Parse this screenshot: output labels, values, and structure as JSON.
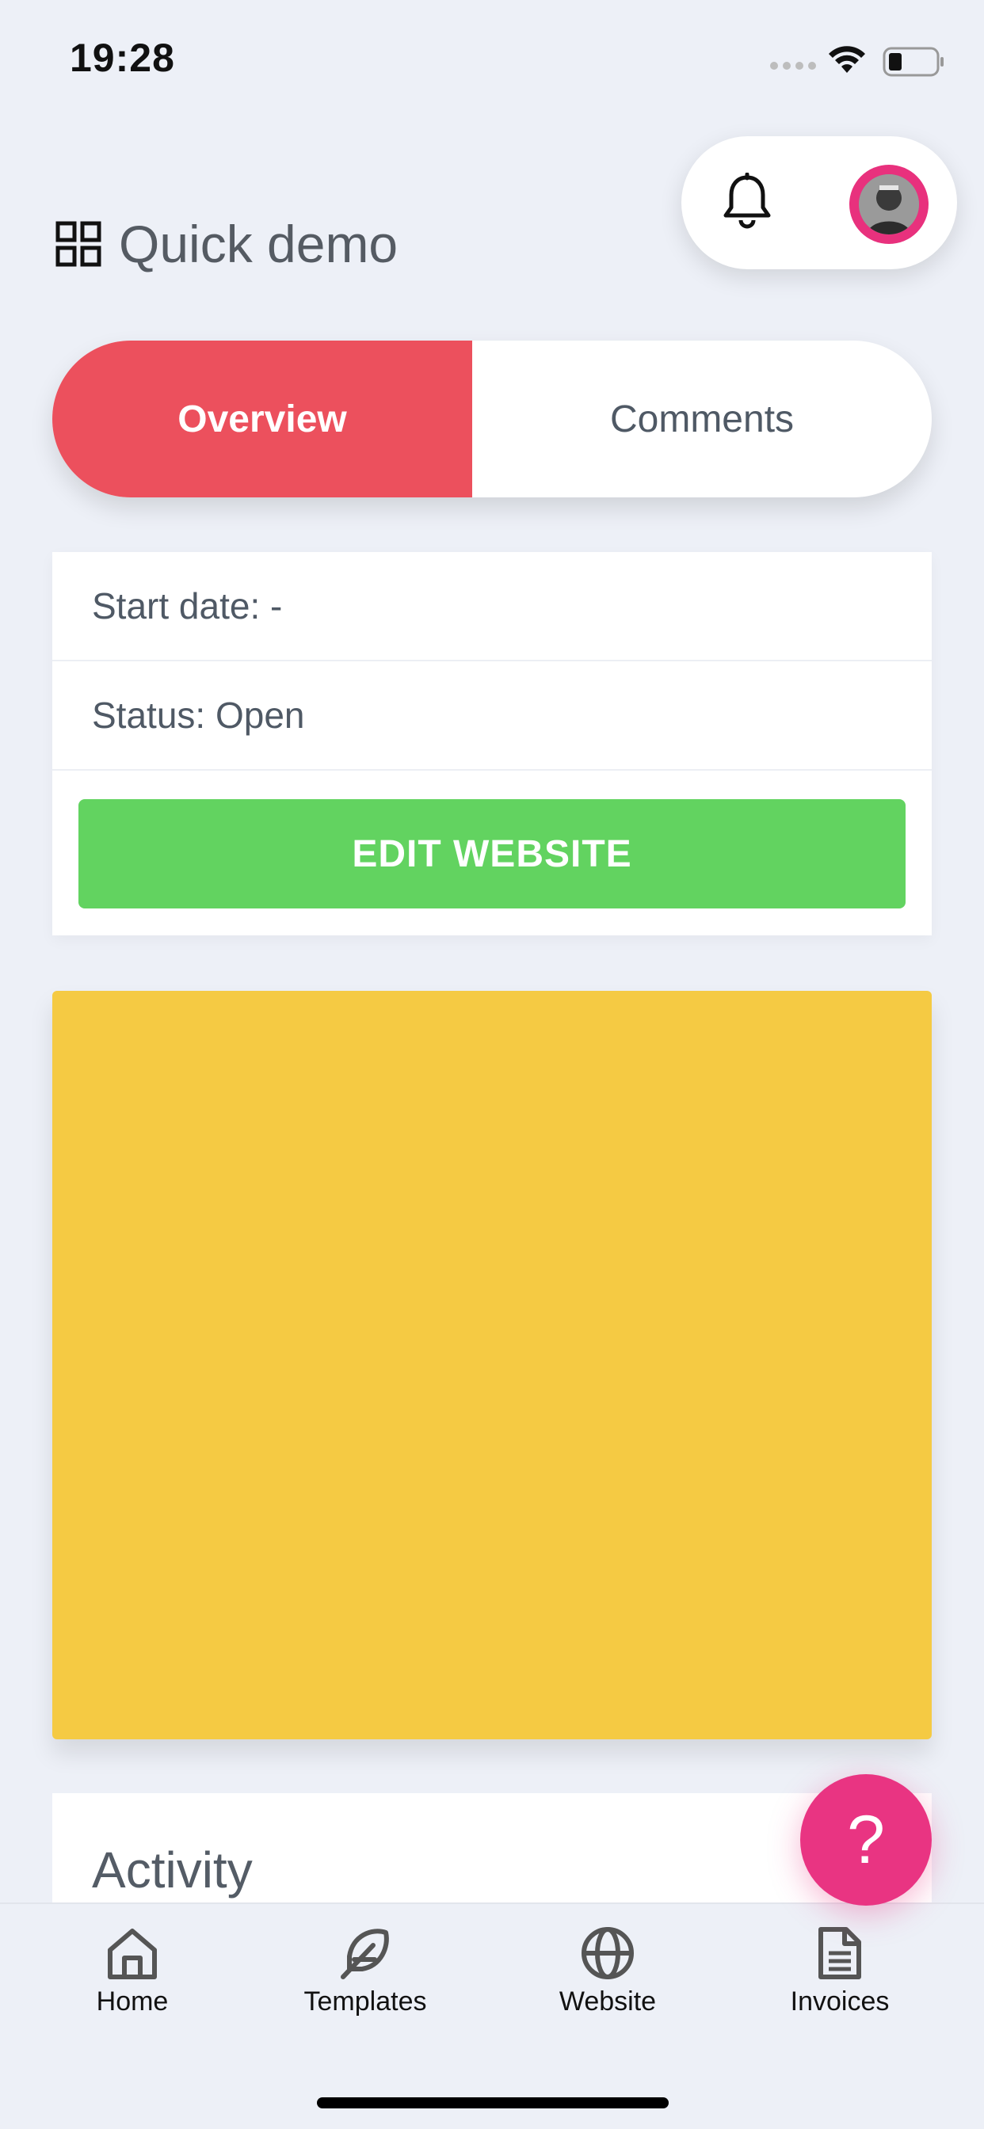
{
  "status_bar": {
    "time": "19:28"
  },
  "header": {
    "title": "Quick demo",
    "title_icon": "grid-icon",
    "notification_icon": "bell-icon",
    "avatar": "user-avatar"
  },
  "tabs": [
    {
      "label": "Overview",
      "active": true
    },
    {
      "label": "Comments",
      "active": false
    }
  ],
  "info": {
    "start_date": "Start date: -",
    "status": "Status: Open",
    "edit_button": "EDIT WEBSITE"
  },
  "activity": {
    "title": "Activity"
  },
  "help_button": {
    "label": "?"
  },
  "bottom_nav": [
    {
      "label": "Home",
      "icon": "home-icon"
    },
    {
      "label": "Templates",
      "icon": "feather-icon"
    },
    {
      "label": "Website",
      "icon": "globe-icon"
    },
    {
      "label": "Invoices",
      "icon": "document-icon"
    }
  ],
  "colors": {
    "background": "#edf0f7",
    "tab_active": "#ec505d",
    "edit_button": "#62d360",
    "preview": "#f5ca43",
    "help_button": "#e93482"
  }
}
